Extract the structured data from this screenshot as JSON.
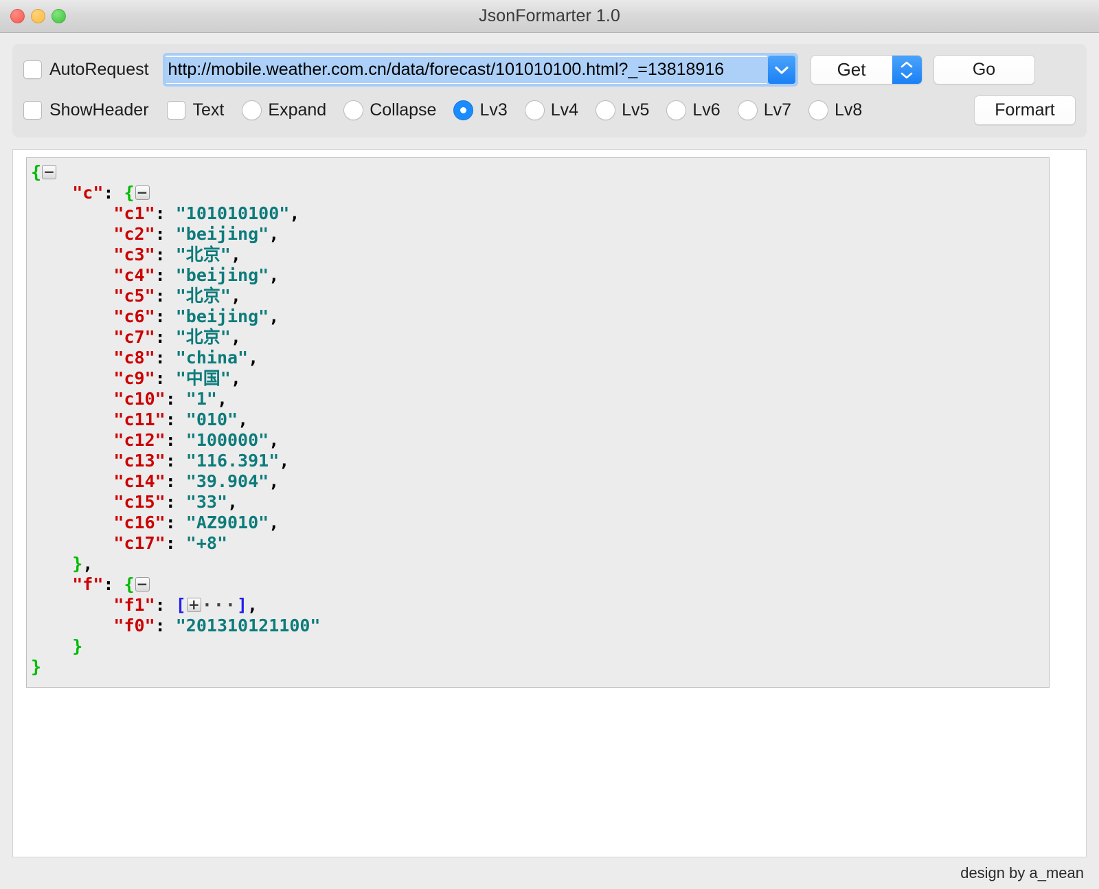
{
  "window": {
    "title": "JsonFormarter 1.0",
    "traffic_lights": [
      "close-button",
      "minimize-button",
      "maximize-button"
    ]
  },
  "toolbar": {
    "auto_request_label": "AutoRequest",
    "auto_request_checked": false,
    "url": {
      "value": "http://mobile.weather.com.cn/data/forecast/101010100.html?_=13818916",
      "placeholder": "http://",
      "dropdown_icon": "chevron-down-icon",
      "selected": true
    },
    "method": {
      "value": "Get",
      "stepper_icon": "chevron-up-down-icon"
    },
    "go_label": "Go",
    "show_header_label": "ShowHeader",
    "show_header_checked": false,
    "text_label": "Text",
    "text_checked": false,
    "mode_options": [
      {
        "label": "Expand",
        "selected": false
      },
      {
        "label": "Collapse",
        "selected": false
      },
      {
        "label": "Lv3",
        "selected": true
      },
      {
        "label": "Lv4",
        "selected": false
      },
      {
        "label": "Lv5",
        "selected": false
      },
      {
        "label": "Lv6",
        "selected": false
      },
      {
        "label": "Lv7",
        "selected": false
      },
      {
        "label": "Lv8",
        "selected": false
      }
    ],
    "format_label": "Formart"
  },
  "json_view": {
    "root_toggle": "−",
    "c_toggle": "−",
    "f_toggle": "−",
    "f1_toggle": "+",
    "f1_ellipsis": "···",
    "root_key": "c",
    "f_key": "f",
    "c_entries": [
      {
        "key": "c1",
        "value": "101010100"
      },
      {
        "key": "c2",
        "value": "beijing"
      },
      {
        "key": "c3",
        "value": "北京"
      },
      {
        "key": "c4",
        "value": "beijing"
      },
      {
        "key": "c5",
        "value": "北京"
      },
      {
        "key": "c6",
        "value": "beijing"
      },
      {
        "key": "c7",
        "value": "北京"
      },
      {
        "key": "c8",
        "value": "china"
      },
      {
        "key": "c9",
        "value": "中国"
      },
      {
        "key": "c10",
        "value": "1"
      },
      {
        "key": "c11",
        "value": "010"
      },
      {
        "key": "c12",
        "value": "100000"
      },
      {
        "key": "c13",
        "value": "116.391"
      },
      {
        "key": "c14",
        "value": "39.904"
      },
      {
        "key": "c15",
        "value": "33"
      },
      {
        "key": "c16",
        "value": "AZ9010"
      },
      {
        "key": "c17",
        "value": "+8"
      }
    ],
    "f_entries": [
      {
        "key": "f1",
        "value": "[ ··· ]",
        "collapsed_array": true
      },
      {
        "key": "f0",
        "value": "201310121100",
        "collapsed_array": false
      }
    ]
  },
  "footer": {
    "credit": "design by a_mean"
  },
  "colors": {
    "accent_blue": "#1a8cff",
    "key_red": "#cc0000",
    "string_teal": "#0e7b7b",
    "brace_green": "#00bb00",
    "bracket_blue": "#2222ee",
    "panel_gray": "#ececec",
    "selection_blue": "#acd0f7"
  }
}
